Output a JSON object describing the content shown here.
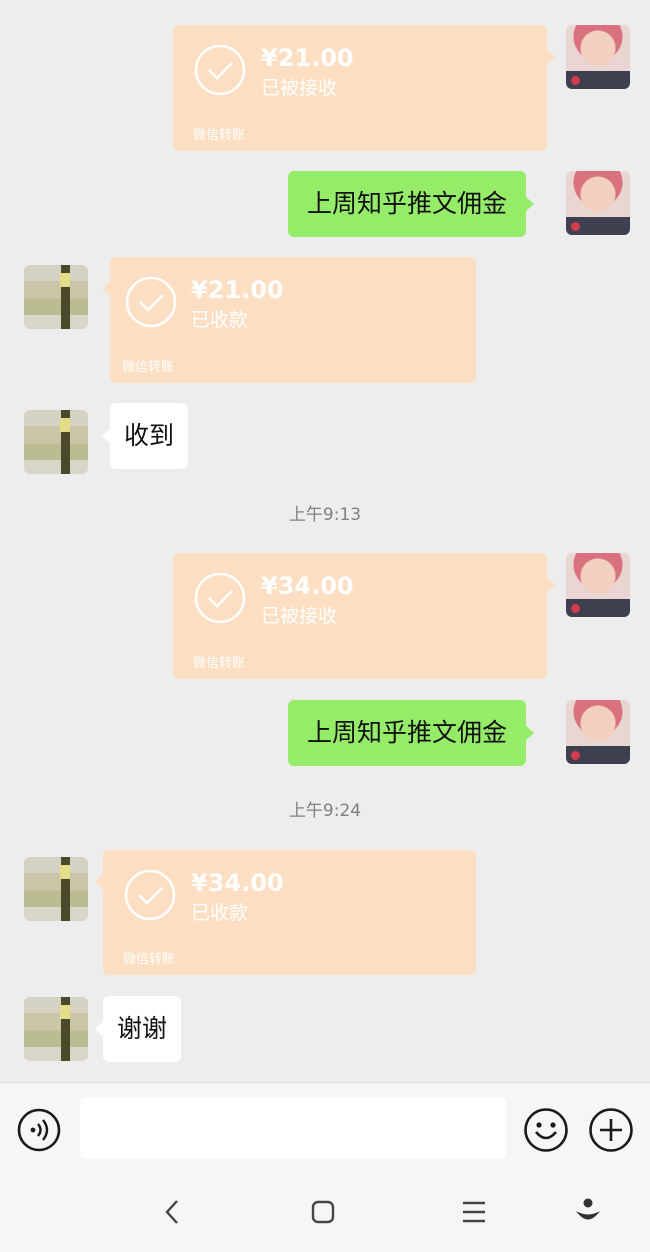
{
  "messages": {
    "m1": {
      "amount": "¥21.00",
      "status": "已被接收",
      "footer": "微信转账"
    },
    "m2": {
      "text": "上周知乎推文佣金"
    },
    "m3": {
      "amount": "¥21.00",
      "status": "已收款",
      "footer": "微信转账"
    },
    "m4": {
      "text": "收到"
    },
    "t1": {
      "time": "上午9:13"
    },
    "m5": {
      "amount": "¥34.00",
      "status": "已被接收",
      "footer": "微信转账"
    },
    "m6": {
      "text": "上周知乎推文佣金"
    },
    "t2": {
      "time": "上午9:24"
    },
    "m7": {
      "amount": "¥34.00",
      "status": "已收款",
      "footer": "微信转账"
    },
    "m8": {
      "text": "谢谢"
    }
  },
  "input": {
    "value": "",
    "placeholder": ""
  },
  "icons": {
    "voice": "voice-icon",
    "emoji": "emoji-icon",
    "plus": "plus-icon",
    "back": "back-icon",
    "home": "home-icon",
    "menu": "menu-icon",
    "assistant": "assistant-icon"
  },
  "colors": {
    "chat_background": "#ededed",
    "sent_bubble": "#95ec69",
    "received_bubble": "#ffffff",
    "transfer_card": "#fcdfc2"
  }
}
